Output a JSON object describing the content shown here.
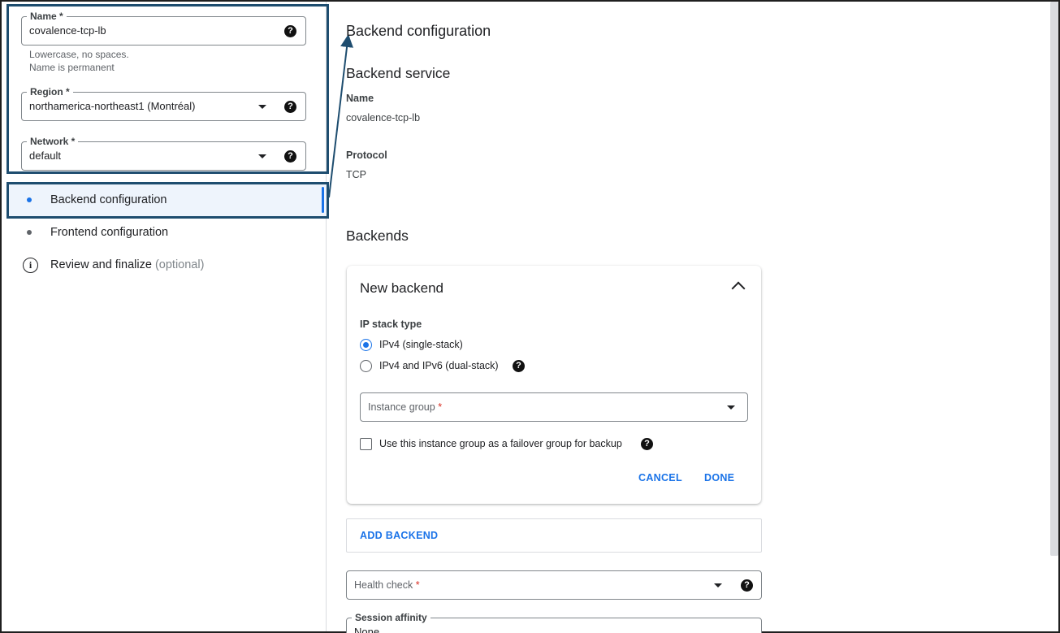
{
  "left": {
    "name_field": {
      "label": "Name *",
      "value": "covalence-tcp-lb"
    },
    "name_hints": [
      "Lowercase, no spaces.",
      "Name is permanent"
    ],
    "region_field": {
      "label": "Region *",
      "value": "northamerica-northeast1 (Montréal)"
    },
    "network_field": {
      "label": "Network *",
      "value": "default"
    },
    "steps": [
      {
        "label": "Backend configuration",
        "active": true
      },
      {
        "label": "Frontend configuration",
        "active": false
      },
      {
        "label": "Review and finalize",
        "suffix": "(optional)",
        "active": false
      }
    ]
  },
  "main": {
    "title": "Backend configuration",
    "backend_service": {
      "heading": "Backend service",
      "name_label": "Name",
      "name_value": "covalence-tcp-lb",
      "protocol_label": "Protocol",
      "protocol_value": "TCP"
    },
    "backends_heading": "Backends",
    "new_backend": {
      "title": "New backend",
      "ip_stack_label": "IP stack type",
      "options": [
        "IPv4 (single-stack)",
        "IPv4 and IPv6 (dual-stack)"
      ],
      "selected_option": 0,
      "instance_group_placeholder": "Instance group",
      "required_mark": "*",
      "failover_label": "Use this instance group as a failover group for backup",
      "cancel_label": "CANCEL",
      "done_label": "DONE"
    },
    "add_backend_label": "ADD BACKEND",
    "health_check": {
      "placeholder": "Health check",
      "required_mark": "*"
    },
    "session_affinity": {
      "label": "Session affinity",
      "value": "None"
    }
  },
  "icons": {
    "help": "help-circle-icon",
    "info": "info-icon",
    "dropdown": "caret-down-icon",
    "collapse": "chevron-up-icon"
  },
  "colors": {
    "accent": "#1a73e8",
    "highlight_border": "#1e4d6f",
    "required": "#d93025"
  }
}
